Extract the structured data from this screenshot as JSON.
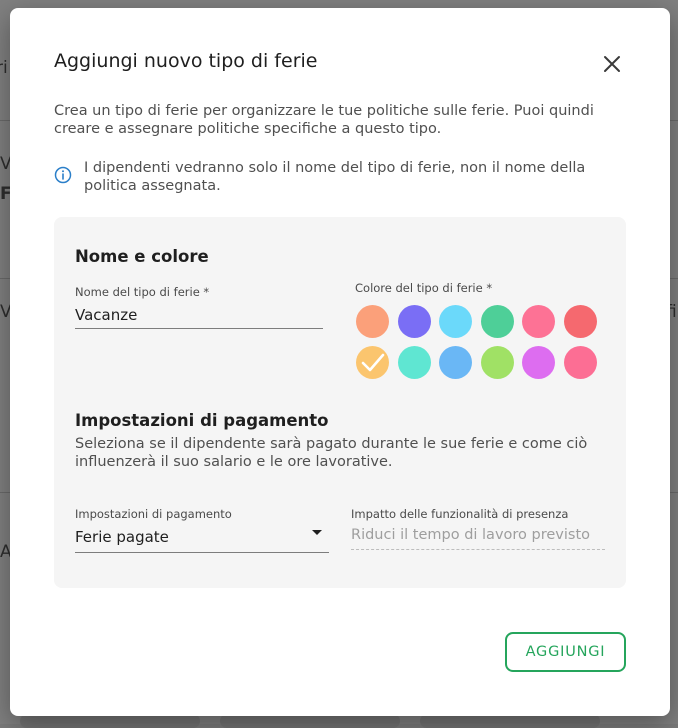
{
  "dialog": {
    "title": "Aggiungi nuovo tipo di ferie",
    "description": "Crea un tipo di ferie per organizzare le tue politiche sulle ferie. Puoi quindi creare e assegnare politiche specifiche a questo tipo.",
    "info": "I dipendenti vedranno solo il nome del tipo di ferie, non il nome della politica assegnata.",
    "close_icon": "close-icon",
    "info_icon": "info-icon"
  },
  "name_color": {
    "title": "Nome e colore",
    "name_label": "Nome del tipo di ferie *",
    "name_value": "Vacanze",
    "color_label": "Colore del tipo di ferie *",
    "colors": [
      "#fba07a",
      "#7a6ef5",
      "#6bd9fa",
      "#4ecf98",
      "#fd7295",
      "#f5696f",
      "#fbc56e",
      "#5fe6d2",
      "#6ab7f5",
      "#a0e165",
      "#dd6df0",
      "#fc6e94"
    ],
    "selected_color_index": 6
  },
  "payment": {
    "title": "Impostazioni di pagamento",
    "description": "Seleziona se il dipendente sarà pagato durante le sue ferie e come ciò influenzerà il suo salario e le ore lavorative.",
    "settings_label": "Impostazioni di pagamento",
    "settings_value": "Ferie pagate",
    "impact_label": "Impatto delle funzionalità di presenza",
    "impact_placeholder": "Riduci il tempo di lavoro previsto"
  },
  "actions": {
    "add_label": "AGGIUNGI",
    "accent": "#25a55c"
  }
}
